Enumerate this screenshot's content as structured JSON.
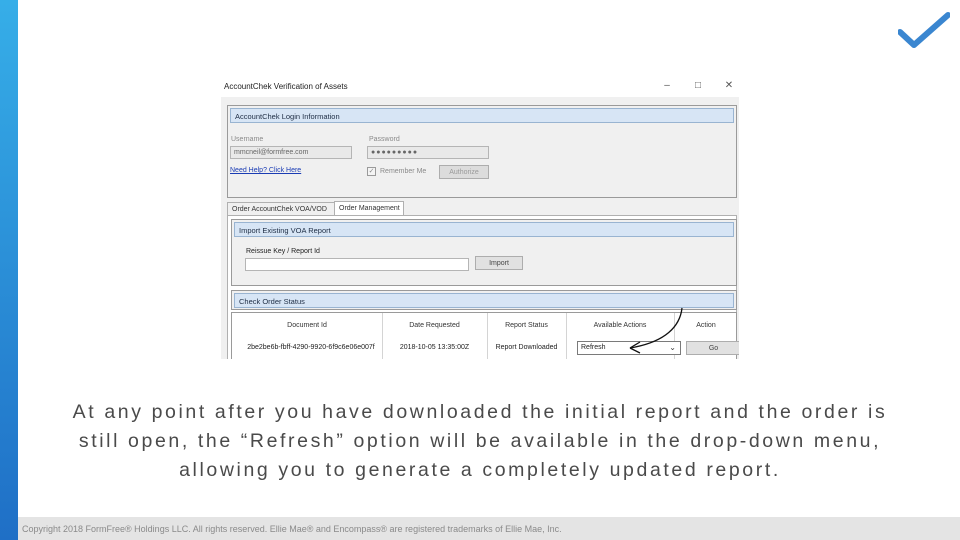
{
  "slide": {
    "caption": "At any point after you have downloaded the initial report and the order is still open, the “Refresh” option will be available in the drop-down menu, allowing you to generate a completely updated report.",
    "footer": "Copyright 2018 FormFree® Holdings LLC. All rights reserved. Ellie Mae® and Encompass® are registered trademarks of Ellie Mae, Inc.",
    "accent_color": "#2e8fd8",
    "check_color": "#3a86d0"
  },
  "window": {
    "title": "AccountChek Verification of Assets",
    "minimize": "–",
    "maximize": "□",
    "close": "✕"
  },
  "login": {
    "header": "AccountChek Login Information",
    "username_label": "Username",
    "username_value": "mmcneil@formfree.com",
    "password_label": "Password",
    "password_value": "●●●●●●●●●",
    "help_link": "Need Help? Click Here",
    "remember_label": "Remember Me",
    "remember_check": "✓",
    "authorize_button": "Authorize"
  },
  "tabs": [
    {
      "label": "Order AccountChek VOA/VOD"
    },
    {
      "label": "Order Management"
    }
  ],
  "import": {
    "header": "Import Existing VOA Report",
    "key_label": "Reissue Key / Report Id",
    "key_value": "",
    "import_button": "Import"
  },
  "status": {
    "header": "Check Order Status",
    "columns": [
      "Document Id",
      "Date Requested",
      "Report Status",
      "Available Actions",
      "Action"
    ],
    "row": {
      "document_id": "2be2be6b-fbff-4290-9920-6f9c6e06e007f",
      "date_requested": "2018-10-05 13:35:00Z",
      "report_status": "Report Downloaded",
      "available_action": "Refresh",
      "action_button": "Go"
    }
  }
}
